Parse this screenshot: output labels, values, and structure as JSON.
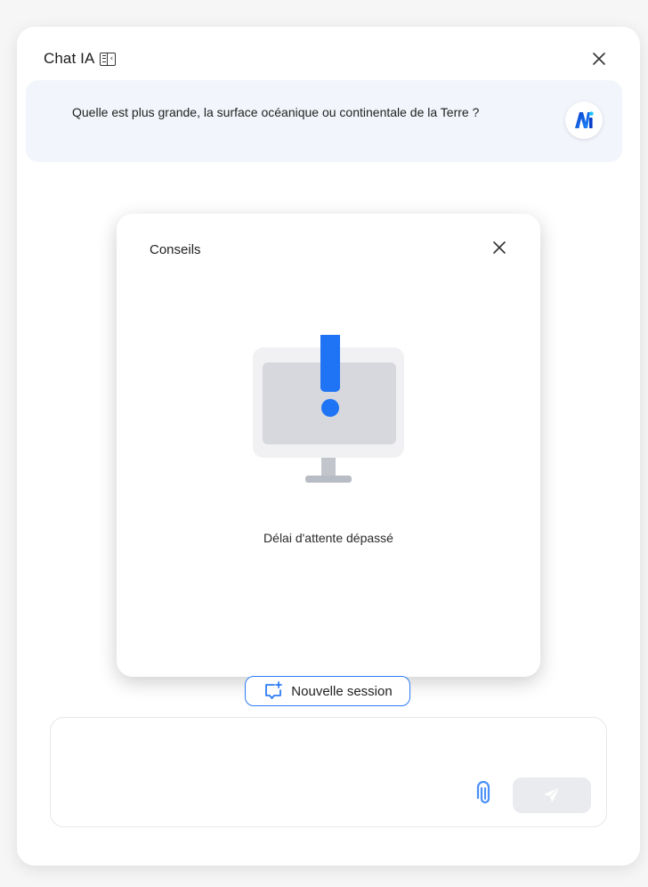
{
  "header": {
    "title": "Chat IA",
    "sidebar_toggle_icon": "sidebar-collapse-icon",
    "close_icon": "close-icon"
  },
  "conversation": {
    "user_message": "Quelle est plus grande, la surface océanique ou continentale de la Terre ?",
    "assistant_avatar_icon": "ai-logo-icon"
  },
  "modal": {
    "title": "Conseils",
    "close_icon": "close-icon",
    "illustration_icon": "monitor-alert-icon",
    "message": "Délai d'attente dépassé"
  },
  "new_session": {
    "label": "Nouvelle session",
    "icon": "chat-add-icon"
  },
  "composer": {
    "placeholder": "",
    "attach_icon": "paperclip-icon",
    "send_icon": "send-icon"
  },
  "colors": {
    "accent": "#2d7cf6",
    "alert_blue": "#1f74f6",
    "message_bg": "#f2f5fb",
    "send_disabled_bg": "#e9ebee"
  }
}
